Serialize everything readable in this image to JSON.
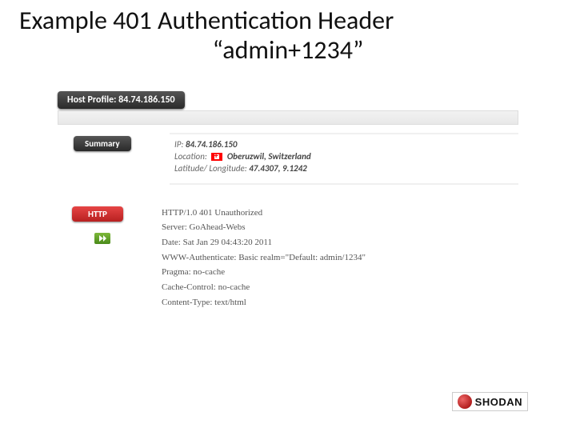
{
  "title_line1": "Example 401 Authentication Header",
  "title_line2": "“admin+1234”",
  "host_bar": "Host Profile: 84.74.186.150",
  "tabs": {
    "summary": "Summary"
  },
  "summary": {
    "ip_label": "IP:",
    "ip_value": "84.74.186.150",
    "location_label": "Location:",
    "location_value": "Oberuzwil, Switzerland",
    "latlng_label": "Latitude/ Longitude:",
    "latlng_value": "47.4307, 9.1242"
  },
  "http": {
    "badge": "HTTP",
    "arrow_icon": "arrow-right-icon",
    "headers": [
      "HTTP/1.0 401 Unauthorized",
      "Server: GoAhead-Webs",
      "Date: Sat Jan 29 04:43:20 2011",
      "WWW-Authenticate: Basic realm=\"Default: admin/1234\"",
      "Pragma: no-cache",
      "Cache-Control: no-cache",
      "Content-Type: text/html"
    ]
  },
  "footer_brand": "SHODAN"
}
